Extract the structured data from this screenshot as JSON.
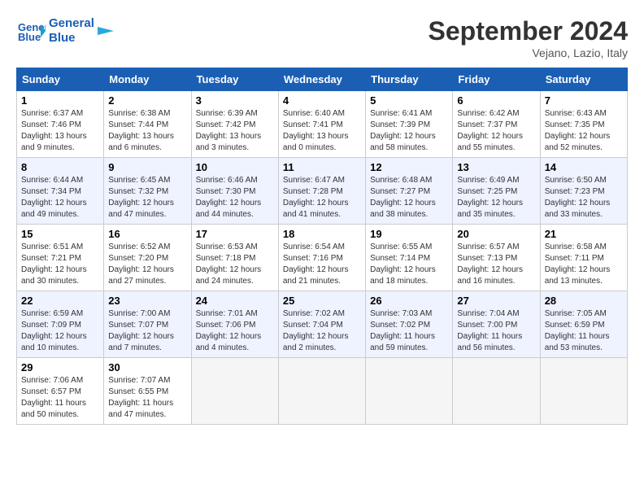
{
  "header": {
    "logo_line1": "General",
    "logo_line2": "Blue",
    "month_year": "September 2024",
    "location": "Vejano, Lazio, Italy"
  },
  "columns": [
    "Sunday",
    "Monday",
    "Tuesday",
    "Wednesday",
    "Thursday",
    "Friday",
    "Saturday"
  ],
  "weeks": [
    [
      {
        "day": "1",
        "sunrise": "6:37 AM",
        "sunset": "7:46 PM",
        "daylight": "13 hours and 9 minutes."
      },
      {
        "day": "2",
        "sunrise": "6:38 AM",
        "sunset": "7:44 PM",
        "daylight": "13 hours and 6 minutes."
      },
      {
        "day": "3",
        "sunrise": "6:39 AM",
        "sunset": "7:42 PM",
        "daylight": "13 hours and 3 minutes."
      },
      {
        "day": "4",
        "sunrise": "6:40 AM",
        "sunset": "7:41 PM",
        "daylight": "13 hours and 0 minutes."
      },
      {
        "day": "5",
        "sunrise": "6:41 AM",
        "sunset": "7:39 PM",
        "daylight": "12 hours and 58 minutes."
      },
      {
        "day": "6",
        "sunrise": "6:42 AM",
        "sunset": "7:37 PM",
        "daylight": "12 hours and 55 minutes."
      },
      {
        "day": "7",
        "sunrise": "6:43 AM",
        "sunset": "7:35 PM",
        "daylight": "12 hours and 52 minutes."
      }
    ],
    [
      {
        "day": "8",
        "sunrise": "6:44 AM",
        "sunset": "7:34 PM",
        "daylight": "12 hours and 49 minutes."
      },
      {
        "day": "9",
        "sunrise": "6:45 AM",
        "sunset": "7:32 PM",
        "daylight": "12 hours and 47 minutes."
      },
      {
        "day": "10",
        "sunrise": "6:46 AM",
        "sunset": "7:30 PM",
        "daylight": "12 hours and 44 minutes."
      },
      {
        "day": "11",
        "sunrise": "6:47 AM",
        "sunset": "7:28 PM",
        "daylight": "12 hours and 41 minutes."
      },
      {
        "day": "12",
        "sunrise": "6:48 AM",
        "sunset": "7:27 PM",
        "daylight": "12 hours and 38 minutes."
      },
      {
        "day": "13",
        "sunrise": "6:49 AM",
        "sunset": "7:25 PM",
        "daylight": "12 hours and 35 minutes."
      },
      {
        "day": "14",
        "sunrise": "6:50 AM",
        "sunset": "7:23 PM",
        "daylight": "12 hours and 33 minutes."
      }
    ],
    [
      {
        "day": "15",
        "sunrise": "6:51 AM",
        "sunset": "7:21 PM",
        "daylight": "12 hours and 30 minutes."
      },
      {
        "day": "16",
        "sunrise": "6:52 AM",
        "sunset": "7:20 PM",
        "daylight": "12 hours and 27 minutes."
      },
      {
        "day": "17",
        "sunrise": "6:53 AM",
        "sunset": "7:18 PM",
        "daylight": "12 hours and 24 minutes."
      },
      {
        "day": "18",
        "sunrise": "6:54 AM",
        "sunset": "7:16 PM",
        "daylight": "12 hours and 21 minutes."
      },
      {
        "day": "19",
        "sunrise": "6:55 AM",
        "sunset": "7:14 PM",
        "daylight": "12 hours and 18 minutes."
      },
      {
        "day": "20",
        "sunrise": "6:57 AM",
        "sunset": "7:13 PM",
        "daylight": "12 hours and 16 minutes."
      },
      {
        "day": "21",
        "sunrise": "6:58 AM",
        "sunset": "7:11 PM",
        "daylight": "12 hours and 13 minutes."
      }
    ],
    [
      {
        "day": "22",
        "sunrise": "6:59 AM",
        "sunset": "7:09 PM",
        "daylight": "12 hours and 10 minutes."
      },
      {
        "day": "23",
        "sunrise": "7:00 AM",
        "sunset": "7:07 PM",
        "daylight": "12 hours and 7 minutes."
      },
      {
        "day": "24",
        "sunrise": "7:01 AM",
        "sunset": "7:06 PM",
        "daylight": "12 hours and 4 minutes."
      },
      {
        "day": "25",
        "sunrise": "7:02 AM",
        "sunset": "7:04 PM",
        "daylight": "12 hours and 2 minutes."
      },
      {
        "day": "26",
        "sunrise": "7:03 AM",
        "sunset": "7:02 PM",
        "daylight": "11 hours and 59 minutes."
      },
      {
        "day": "27",
        "sunrise": "7:04 AM",
        "sunset": "7:00 PM",
        "daylight": "11 hours and 56 minutes."
      },
      {
        "day": "28",
        "sunrise": "7:05 AM",
        "sunset": "6:59 PM",
        "daylight": "11 hours and 53 minutes."
      }
    ],
    [
      {
        "day": "29",
        "sunrise": "7:06 AM",
        "sunset": "6:57 PM",
        "daylight": "11 hours and 50 minutes."
      },
      {
        "day": "30",
        "sunrise": "7:07 AM",
        "sunset": "6:55 PM",
        "daylight": "11 hours and 47 minutes."
      },
      null,
      null,
      null,
      null,
      null
    ]
  ],
  "labels": {
    "sunrise": "Sunrise:",
    "sunset": "Sunset:",
    "daylight": "Daylight:"
  }
}
